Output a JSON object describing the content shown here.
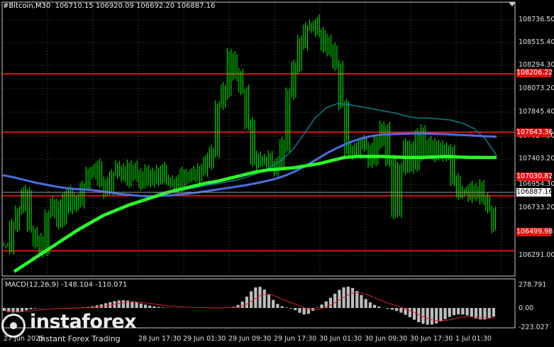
{
  "header": {
    "symbol": "#Bitcoin,M30",
    "ohlc": "106710.15 106920.09 106692.20 106887.16"
  },
  "macd": {
    "label": "MACD(12,26,9) -148.104 -110.071",
    "axis_ticks": [
      "278.791",
      "0.00",
      "-223.027"
    ]
  },
  "price_axis": {
    "ticks": [
      "108736.50",
      "108515.40",
      "108294.30",
      "108073.20",
      "107845.40",
      "107624.30",
      "107403.20",
      "106954.30",
      "106733.20",
      "106291.00"
    ]
  },
  "levels": [
    {
      "price": 108206.22,
      "label": "108206.22"
    },
    {
      "price": 107643.36,
      "label": "107643.36"
    },
    {
      "price": 107030.82,
      "label": "107030.82"
    },
    {
      "price": 106499.98,
      "label": "106499.98"
    }
  ],
  "current_price": {
    "price": 106887.16,
    "label": "106887.16"
  },
  "time_axis": [
    "27 Jun 2025",
    "28 Jun 17:30",
    "29 Jun 01:30",
    "29 Jun 09:30",
    "29 Jun 17:30",
    "30 Jun 01:30",
    "30 Jun 09:30",
    "30 Jun 17:30",
    "1 Jul 01:30"
  ],
  "logo": {
    "name": "instaforex",
    "tagline": "Instant Forex Trading"
  },
  "colors": {
    "background": "#000000",
    "candles": "#00ff00",
    "level_lines": "#ff1a1a",
    "ma_fast": "#4a6ee0",
    "ma_medium": "#0f7f8c",
    "ma_slow": "#2bff2b",
    "macd_hist": "#bdbdbd",
    "macd_signal": "#e02020"
  },
  "chart_data": {
    "type": "line",
    "y_range": [
      106291.0,
      108850.0
    ],
    "series": [
      {
        "name": "close",
        "values": [
          106550,
          106750,
          106900,
          107050,
          106700,
          106600,
          106500,
          106850,
          106950,
          106800,
          107050,
          106900,
          107000,
          107150,
          107250,
          107300,
          107150,
          107100,
          107250,
          107300,
          107200,
          107300,
          107250,
          107150,
          107250,
          107200,
          107300,
          107200,
          107150,
          107150,
          107250,
          107200,
          107250,
          107300,
          107350,
          107450,
          107900,
          108050,
          108400,
          108200,
          108050,
          107700,
          107400,
          107350,
          107400,
          107300,
          107350,
          107500,
          108000,
          108300,
          108500,
          108650,
          108700,
          108600,
          108500,
          108450,
          108300,
          107900,
          107500,
          107450,
          107550,
          107500,
          107400,
          107550,
          107700,
          107350,
          106900,
          107300,
          107500,
          107300,
          107650,
          107450,
          107550,
          107400,
          107500,
          107450,
          107200,
          107050,
          107100,
          107050,
          107100,
          107000,
          106900,
          106760
        ]
      },
      {
        "name": "ma_fast",
        "values": [
          107230,
          107210,
          107185,
          107160,
          107140,
          107120,
          107105,
          107095,
          107090,
          107080,
          107065,
          107050,
          107040,
          107030,
          107025,
          107030,
          107035,
          107045,
          107055,
          107070,
          107085,
          107100,
          107115,
          107130,
          107150,
          107170,
          107195,
          107230,
          107275,
          107330,
          107390,
          107450,
          107500,
          107545,
          107580,
          107605,
          107620,
          107625,
          107628,
          107630,
          107630,
          107628,
          107625,
          107620,
          107615,
          107610,
          107605,
          107600
        ]
      },
      {
        "name": "ma_medium",
        "values": [
          107060,
          107070,
          107080,
          107100,
          107120,
          107140,
          107160,
          107180,
          107210,
          107250,
          107300,
          107370,
          107470,
          107620,
          107780,
          107880,
          107920,
          107910,
          107890,
          107870,
          107850,
          107830,
          107800,
          107780,
          107780,
          107770,
          107760,
          107730,
          107680,
          107580,
          107420
        ]
      },
      {
        "name": "ma_slow",
        "values": [
          106300,
          106380,
          106460,
          106540,
          106620,
          106700,
          106770,
          106840,
          106890,
          106940,
          106980,
          107020,
          107060,
          107090,
          107120,
          107150,
          107170,
          107200,
          107230,
          107260,
          107280,
          107290,
          107300,
          107320,
          107340,
          107370,
          107400,
          107410,
          107410,
          107410,
          107405,
          107400,
          107400,
          107405,
          107410,
          107405,
          107400,
          107400,
          107400
        ]
      }
    ]
  }
}
